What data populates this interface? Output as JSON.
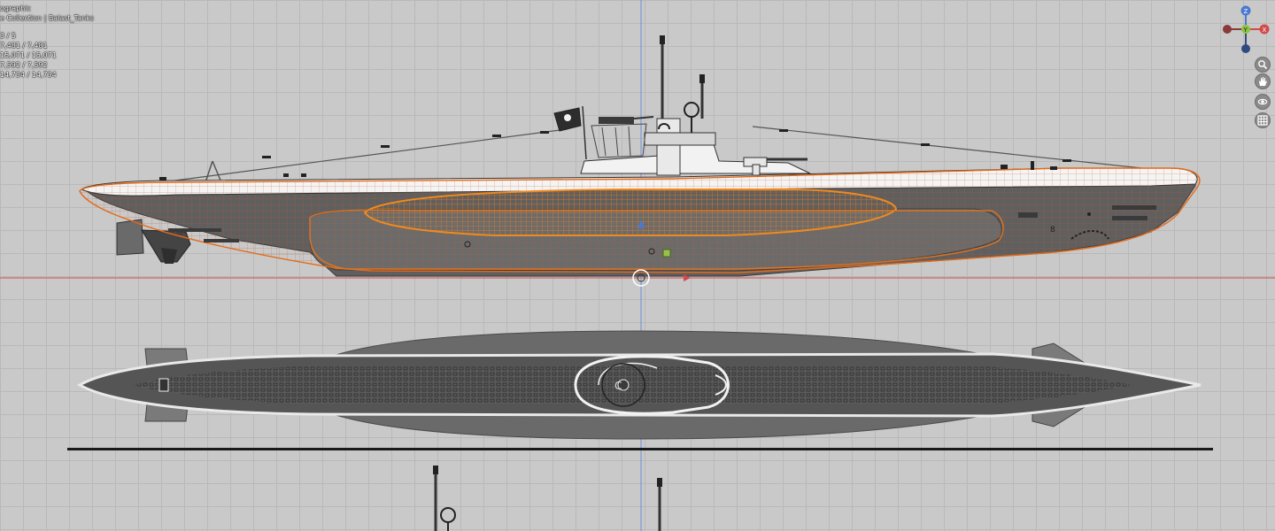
{
  "overlay": {
    "view_name": "ographic",
    "collection_path": "e Collection | Balast_Tanks",
    "stats": {
      "objects": "3 / 5",
      "vertices": "7,481 / 7,481",
      "edges": "15,071 / 15,071",
      "faces": "7,592 / 7,592",
      "triangles": "14,734 / 14,734"
    }
  },
  "gizmo": {
    "z_label": "Z",
    "y_label": "Y",
    "x_label": "X"
  },
  "nav_icons": [
    "zoom-icon",
    "hand-pan-icon",
    "camera-orbit-icon",
    "grid-toggle-icon"
  ],
  "colors": {
    "background": "#c9c9c9",
    "grid": "#b9b9b9",
    "selection_outline": "#e36a1a",
    "selected_wireframe": "#f08a1e",
    "hull_gray": "#5f5f5f",
    "deck_white": "#f4f4f4",
    "axis_red": "#d24a4a",
    "axis_blue": "#6d8fd6"
  }
}
